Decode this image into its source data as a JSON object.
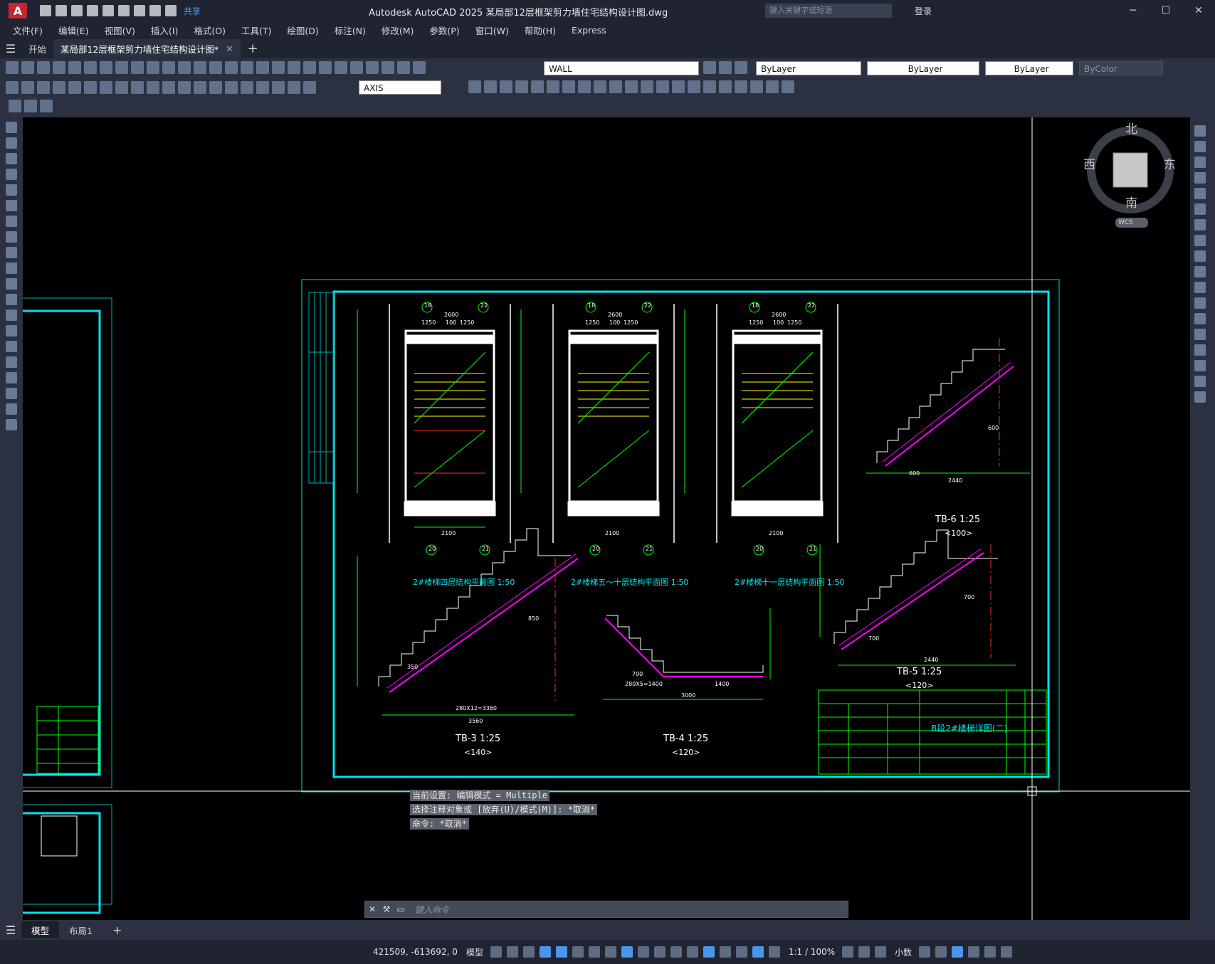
{
  "app": {
    "logo": "A",
    "title": "Autodesk AutoCAD 2025    某局部12层框架剪力墙住宅结构设计图.dwg",
    "share": "共享",
    "search_placeholder": "键入关键字或短语",
    "login": "登录"
  },
  "menu": [
    "文件(F)",
    "编辑(E)",
    "视图(V)",
    "插入(I)",
    "格式(O)",
    "工具(T)",
    "绘图(D)",
    "标注(N)",
    "修改(M)",
    "参数(P)",
    "窗口(W)",
    "帮助(H)",
    "Express"
  ],
  "tabs": [
    {
      "label": "开始"
    },
    {
      "label": "某局部12层框架剪力墙住宅结构设计图*"
    }
  ],
  "toolbar": {
    "layer": "WALL",
    "color": "ByLayer",
    "linetype": "ByLayer",
    "lineweight": "ByLayer",
    "plotstyle": "ByColor",
    "dimstyle": "AXIS"
  },
  "viewcube": {
    "north": "北",
    "south": "南",
    "east": "东",
    "west": "西",
    "wcs": "WCS"
  },
  "drawing": {
    "plans": [
      {
        "title": "2#楼梯四层结构平面图",
        "scale": "1:50",
        "axes": [
          "18",
          "22",
          "20",
          "21"
        ],
        "dims": [
          "2600",
          "1250",
          "100",
          "1250",
          "2100"
        ]
      },
      {
        "title": "2#楼梯五～十层结构平面图",
        "scale": "1:50",
        "axes": [
          "18",
          "22",
          "20",
          "21"
        ],
        "dims": [
          "2600",
          "1250",
          "100",
          "1250",
          "2100"
        ]
      },
      {
        "title": "2#楼梯十一层结构平面图",
        "scale": "1:50",
        "axes": [
          "18",
          "22",
          "20",
          "21"
        ],
        "dims": [
          "2600",
          "1250",
          "100",
          "1250",
          "2100"
        ]
      }
    ],
    "stairs": [
      {
        "name": "TB-6 1:25",
        "sub": "<100>",
        "dims": [
          "600",
          "600",
          "2440"
        ]
      },
      {
        "name": "TB-3 1:25",
        "sub": "<140>",
        "dims": [
          "280X12=3360",
          "3560",
          "850",
          "350"
        ]
      },
      {
        "name": "TB-4 1:25",
        "sub": "<120>",
        "dims": [
          "280X5=1400",
          "3000",
          "1400",
          "700"
        ]
      },
      {
        "name": "TB-5 1:25",
        "sub": "<120>",
        "dims": [
          "700",
          "700",
          "2440"
        ]
      }
    ],
    "title_block": "B段2#楼梯详图(二)"
  },
  "command": {
    "history": [
      "当前设置: 编辑模式 = Multiple",
      "选择注释对象或 [放弃(U)/模式(M)]: *取消*",
      "命令: *取消*"
    ],
    "placeholder": "键入命令"
  },
  "layouts": [
    {
      "label": "模型"
    },
    {
      "label": "布局1"
    }
  ],
  "status": {
    "coords": "421509, -613692, 0",
    "model": "模型",
    "scale": "1:1 / 100%",
    "units": "小数"
  }
}
